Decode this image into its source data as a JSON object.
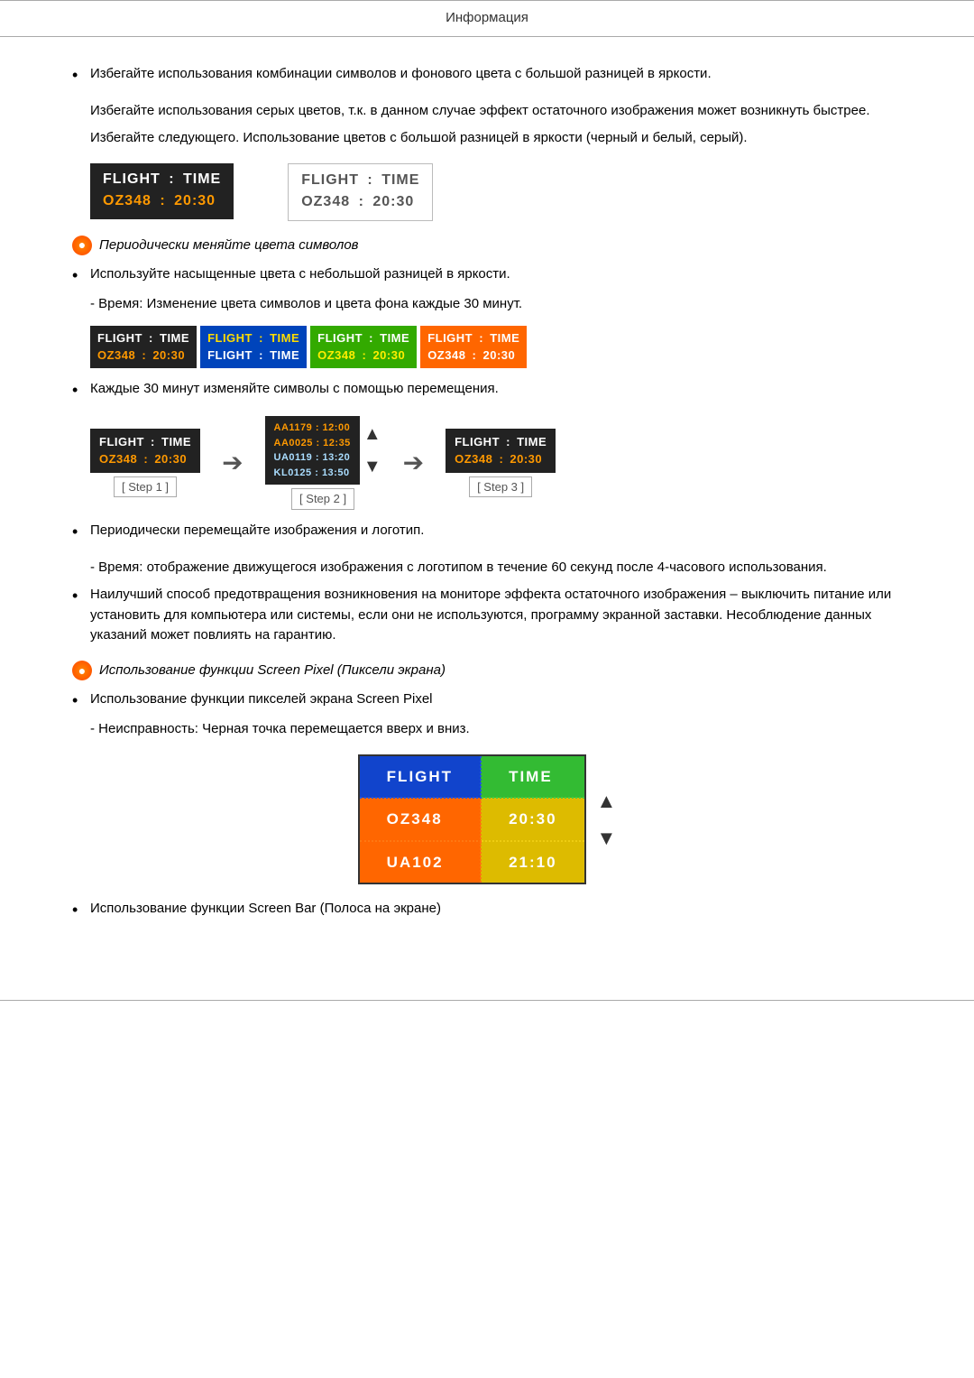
{
  "page": {
    "header": "Информация",
    "sections": [
      {
        "type": "bullet",
        "text": "Избегайте использования комбинации символов и фонового цвета с большой разницей в яркости."
      },
      {
        "type": "subtext",
        "text": "Избегайте использования серых цветов, т.к. в данном случае эффект остаточного изображения может возникнуть быстрее."
      },
      {
        "type": "subtext",
        "text": "Избегайте следующего. Использование цветов с большой разницей в яркости (черный и белый, серый)."
      },
      {
        "type": "special-label",
        "text": "Периодически меняйте цвета символов"
      },
      {
        "type": "bullet",
        "text": "Используйте насыщенные цвета с небольшой разницей в яркости."
      },
      {
        "type": "subtext",
        "text": "- Время: Изменение цвета символов и цвета фона каждые 30 минут."
      },
      {
        "type": "bullet",
        "text": "Каждые 30 минут изменяйте символы с помощью перемещения."
      },
      {
        "type": "bullet",
        "text": "Периодически перемещайте изображения и логотип."
      },
      {
        "type": "subtext",
        "text": "- Время: отображение движущегося изображения с логотипом в течение 60 секунд после 4-часового использования."
      },
      {
        "type": "bullet",
        "text": "Наилучший способ предотвращения возникновения на мониторе эффекта остаточного изображения – выключить питание или установить для компьютера или системы, если они не используются, программу экранной заставки. Несоблюдение данных указаний может повлиять на гарантию."
      },
      {
        "type": "special-label",
        "text": "Использование функции Screen Pixel (Пиксели экрана)"
      },
      {
        "type": "bullet",
        "text": "Использование функции пикселей экрана Screen Pixel"
      },
      {
        "type": "subtext",
        "text": "- Неисправность: Черная точка перемещается вверх и вниз."
      },
      {
        "type": "bullet",
        "text": "Использование функции Screen Bar (Полоса на экране)"
      }
    ],
    "flight_display_1": {
      "label1": "FLIGHT",
      "colon1": ":",
      "label2": "TIME",
      "row2_left": "OZ348",
      "row2_colon": ":",
      "row2_right": "20:30"
    },
    "flight_display_2": {
      "label1": "FLIGHT",
      "colon1": ":",
      "label2": "TIME",
      "row2_left": "OZ348",
      "row2_colon": ":",
      "row2_right": "20:30"
    },
    "step_labels": [
      "[ Step 1 ]",
      "[ Step 2 ]",
      "[ Step 3 ]"
    ],
    "pixel_table": {
      "header_col1": "FLIGHT",
      "header_col2": "TIME",
      "row1_col1": "OZ348",
      "row1_col2": "20:30",
      "row2_col1": "UA102",
      "row2_col2": "21:10"
    }
  }
}
